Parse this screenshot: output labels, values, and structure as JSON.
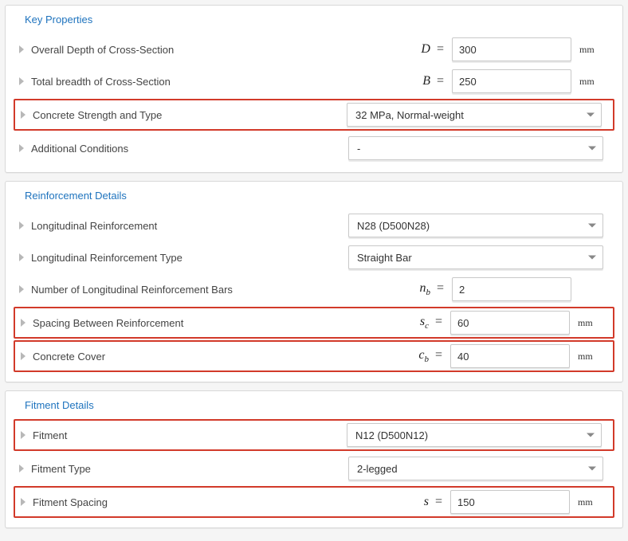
{
  "sections": {
    "key": {
      "title": "Key Properties",
      "depth_label": "Overall Depth of Cross-Section",
      "depth_sym": "D",
      "depth_val": "300",
      "breadth_label": "Total breadth of Cross-Section",
      "breadth_sym": "B",
      "breadth_val": "250",
      "strength_label": "Concrete Strength and Type",
      "strength_val": "32 MPa, Normal-weight",
      "addl_label": "Additional Conditions",
      "addl_val": "-",
      "unit_mm": "mm"
    },
    "reinf": {
      "title": "Reinforcement Details",
      "long_label": "Longitudinal Reinforcement",
      "long_val": "N28 (D500N28)",
      "long_type_label": "Longitudinal Reinforcement Type",
      "long_type_val": "Straight Bar",
      "nbars_label": "Number of Longitudinal Reinforcement Bars",
      "nbars_sym_main": "n",
      "nbars_sym_sub": "b",
      "nbars_val": "2",
      "spacing_label": "Spacing Between Reinforcement",
      "spacing_sym_main": "s",
      "spacing_sym_sub": "c",
      "spacing_val": "60",
      "cover_label": "Concrete Cover",
      "cover_sym_main": "c",
      "cover_sym_sub": "b",
      "cover_val": "40",
      "unit_mm": "mm"
    },
    "fit": {
      "title": "Fitment Details",
      "fitment_label": "Fitment",
      "fitment_val": "N12 (D500N12)",
      "fitment_type_label": "Fitment Type",
      "fitment_type_val": "2-legged",
      "fitment_spacing_label": "Fitment Spacing",
      "fitment_spacing_sym": "s",
      "fitment_spacing_val": "150",
      "unit_mm": "mm"
    }
  }
}
